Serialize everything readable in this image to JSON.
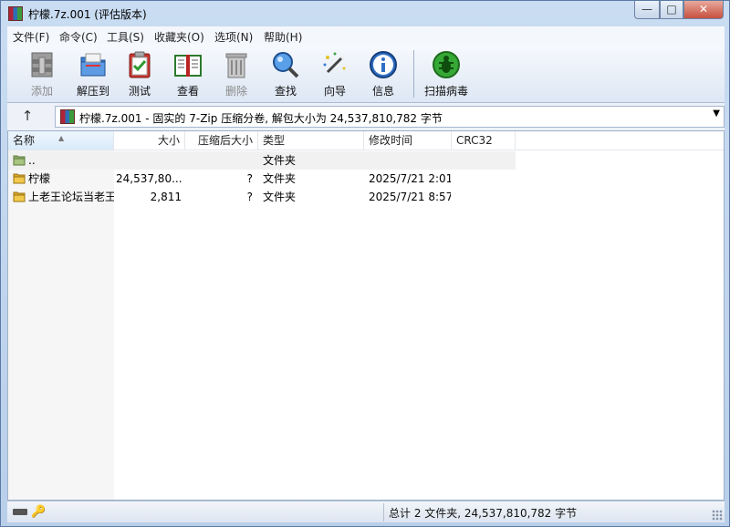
{
  "window": {
    "title": "柠檬.7z.001 (评估版本)",
    "controls": {
      "minimize": "—",
      "maximize": "□",
      "close": "✕"
    }
  },
  "menu": [
    "文件(F)",
    "命令(C)",
    "工具(S)",
    "收藏夹(O)",
    "选项(N)",
    "帮助(H)"
  ],
  "toolbar": [
    {
      "id": "add",
      "label": "添加",
      "icon": "add-archive-icon",
      "disabled": true
    },
    {
      "id": "extract",
      "label": "解压到",
      "icon": "extract-to-icon",
      "disabled": false
    },
    {
      "id": "test",
      "label": "测试",
      "icon": "test-clipboard-icon",
      "disabled": false
    },
    {
      "id": "view",
      "label": "查看",
      "icon": "view-book-icon",
      "disabled": false
    },
    {
      "id": "delete",
      "label": "删除",
      "icon": "delete-trash-icon",
      "disabled": true
    },
    {
      "id": "find",
      "label": "查找",
      "icon": "find-magnifier-icon",
      "disabled": false
    },
    {
      "id": "wizard",
      "label": "向导",
      "icon": "wizard-wand-icon",
      "disabled": false
    },
    {
      "id": "info",
      "label": "信息",
      "icon": "info-icon",
      "disabled": false
    },
    {
      "id": "scan",
      "label": "扫描病毒",
      "icon": "virus-scan-icon",
      "disabled": false
    }
  ],
  "address": {
    "up_glyph": "↑",
    "text": "柠檬.7z.001 - 固实的 7-Zip 压缩分卷, 解包大小为 24,537,810,782 字节"
  },
  "columns": [
    "名称",
    "大小",
    "压缩后大小",
    "类型",
    "修改时间",
    "CRC32"
  ],
  "rows": [
    {
      "name": "..",
      "size": "",
      "packed": "",
      "type": "文件夹",
      "modified": "",
      "crc": "",
      "icon": "folder-up-icon"
    },
    {
      "name": "柠檬",
      "size": "24,537,80...",
      "packed": "?",
      "type": "文件夹",
      "modified": "2025/7/21 2:01",
      "crc": "",
      "icon": "folder-icon"
    },
    {
      "name": "上老王论坛当老王",
      "size": "2,811",
      "packed": "?",
      "type": "文件夹",
      "modified": "2025/7/21 8:57",
      "crc": "",
      "icon": "folder-icon"
    }
  ],
  "status": {
    "text": "总计 2 文件夹, 24,537,810,782 字节"
  }
}
